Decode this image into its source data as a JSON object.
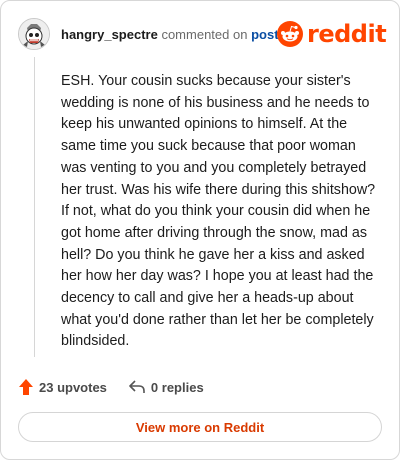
{
  "header": {
    "username": "hangry_spectre",
    "verb": "commented on",
    "post_link": "post",
    "logo_text": "reddit",
    "avatar_icon": "skull-avatar-icon",
    "logo_icon": "reddit-snoo-icon"
  },
  "comment": {
    "text": "ESH. Your cousin sucks because your sister's wedding is none of his business and he needs to keep his unwanted opinions to himself. At the same time you suck because that poor woman was venting to you and you completely betrayed her trust. Was his wife there during this shitshow? If not, what do you think your cousin did when he got home after driving through the snow, mad as hell? Do you think he gave her a kiss and asked her how her day was? I hope you at least had the decency to call and give her a heads-up about what you'd done rather than let her be completely blindsided."
  },
  "actions": {
    "upvotes": "23 upvotes",
    "replies": "0 replies",
    "upvote_icon": "upvote-arrow-icon",
    "reply_icon": "reply-arrow-icon"
  },
  "footer": {
    "view_more": "View more on Reddit"
  },
  "colors": {
    "accent": "#ff4500",
    "link": "#0a4ea3",
    "button_text": "#d93a00"
  }
}
